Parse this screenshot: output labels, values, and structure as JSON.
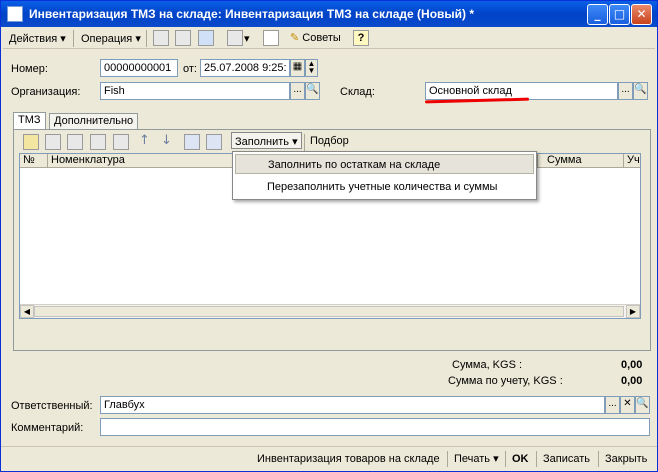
{
  "window": {
    "title": "Инвентаризация ТМЗ на складе: Инвентаризация ТМЗ на складе (Новый) *",
    "minimize": "_",
    "maximize": "□",
    "close": "✕"
  },
  "toolbar": {
    "actions_label": "Действия",
    "operation_label": "Операция",
    "tips_label": "Советы",
    "help_label": "?"
  },
  "form": {
    "number_label": "Номер:",
    "number_value": "00000000001",
    "date_label": "от:",
    "date_value": "25.07.2008  9:25:",
    "org_label": "Организация:",
    "org_value": "Fish",
    "warehouse_label": "Склад:",
    "warehouse_value": "Основной склад",
    "ellipsis": "...",
    "responsible_label": "Ответственный:",
    "responsible_value": "Главбух",
    "comment_label": "Комментарий:",
    "comment_value": ""
  },
  "tabs": [
    "ТМЗ",
    "Дополнительно"
  ],
  "table_toolbar": {
    "fill_label": "Заполнить",
    "select_label": "Подбор"
  },
  "grid": {
    "columns": [
      "№",
      "Номенклатура",
      "Сумма",
      "Уч"
    ]
  },
  "fill_menu": {
    "items": [
      "Заполнить по остаткам на складе",
      "Перезаполнить учетные количества и суммы"
    ]
  },
  "totals": {
    "sum_label": "Сумма, KGS :",
    "sum_value": "0,00",
    "account_sum_label": "Сумма по учету, KGS :",
    "account_sum_value": "0,00"
  },
  "bottom": {
    "print_form_label": "Инвентаризация товаров на складе",
    "print_label": "Печать",
    "ok_label": "OK",
    "save_label": "Записать",
    "close_label": "Закрыть"
  },
  "colors": {
    "title_bar": "#0A5FE6",
    "window_bg": "#ECE9D8",
    "annotation_underline": "#EE0000"
  }
}
